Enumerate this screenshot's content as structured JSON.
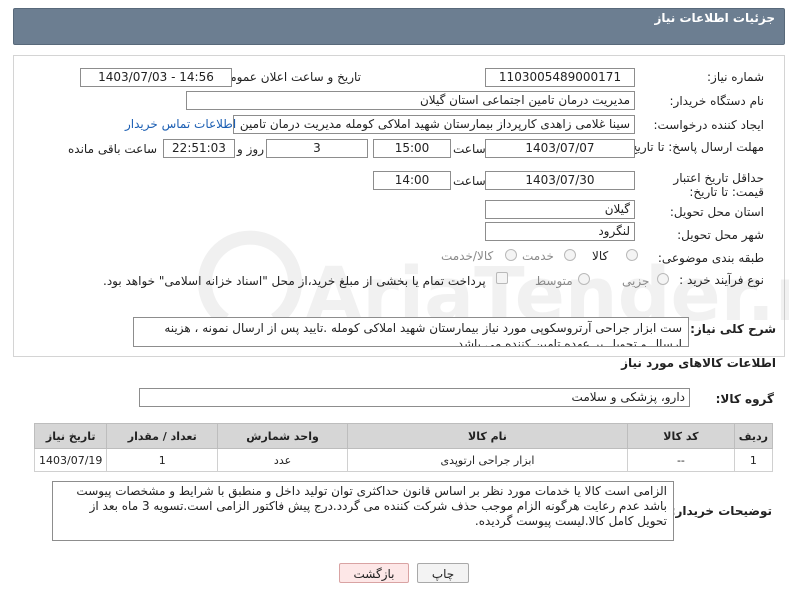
{
  "header": {
    "title": "جزئیات اطلاعات نیاز"
  },
  "watermark": {
    "text": "AriaTender.neT"
  },
  "form": {
    "need_number": {
      "label": "شماره نیاز:",
      "value": "1103005489000171"
    },
    "announce_datetime": {
      "label": "تاریخ و ساعت اعلان عمومی:",
      "value": "1403/07/03 - 14:56"
    },
    "buyer_org": {
      "label": "نام دستگاه خریدار:",
      "value": "مدیریت درمان تامین اجتماعی استان گیلان"
    },
    "requester": {
      "label": "ایجاد کننده درخواست:",
      "value": "سینا غلامی زاهدی کارپرداز بیمارستان شهید املاکی کومله مدیریت درمان تامین",
      "contact_link": "اطلاعات تماس خریدار"
    },
    "reply_deadline": {
      "label": "مهلت ارسال پاسخ: تا تاریخ:",
      "date": "1403/07/07",
      "time_label": "ساعت",
      "time": "15:00",
      "days": "3",
      "days_label": "روز و",
      "remaining": "22:51:03",
      "remaining_label": "ساعت باقی مانده"
    },
    "price_validity": {
      "label": "حداقل تاریخ اعتبار قیمت: تا تاریخ:",
      "date": "1403/07/30",
      "time_label": "ساعت",
      "time": "14:00"
    },
    "delivery_province": {
      "label": "استان محل تحویل:",
      "value": "گیلان"
    },
    "delivery_city": {
      "label": "شهر محل تحویل:",
      "value": "لنگرود"
    },
    "category": {
      "label": "طبقه بندی موضوعی:",
      "options": [
        "کالا",
        "خدمت",
        "کالا/خدمت"
      ]
    },
    "purchase_type": {
      "label": "نوع فرآیند خرید :",
      "options": [
        "جزیی",
        "متوسط"
      ],
      "treasury_note": "پرداخت تمام یا بخشی از مبلغ خرید،از محل \"اسناد خزانه اسلامی\" خواهد بود."
    },
    "need_description": {
      "label": "شرح کلی نیاز:",
      "value": "ست ابزار جراحی آرتروسکوپی مورد نیاز بیمارستان شهید املاکی کومله .تایید پس از ارسال نمونه ، هزینه ارسال و تحویل بر عهده تامین کننده می باشد."
    }
  },
  "goods_section": {
    "title": "اطلاعات کالاهای مورد نیاز",
    "group_label": "گروه کالا:",
    "group_value": "دارو، پزشکی و سلامت",
    "columns": [
      "ردیف",
      "کد کالا",
      "نام کالا",
      "واحد شمارش",
      "تعداد / مقدار",
      "تاریخ نیاز"
    ],
    "rows": [
      [
        "1",
        "--",
        "ابزار جراحی ارتوپدی",
        "عدد",
        "1",
        "1403/07/19"
      ]
    ]
  },
  "buyer_notes": {
    "label": "توضیحات خریدار:",
    "value": "الزامی است کالا یا خدمات مورد نظر بر اساس قانون حداکثری توان تولید داخل و منطبق با شرایط و مشخصات پیوست باشد عدم رعایت هرگونه الزام موجب حذف شرکت کننده می گردد.درج پیش فاکتور الزامی است.تسویه 3 ماه بعد از تحویل کامل کالا.لیست پیوست گردیده."
  },
  "buttons": {
    "print": "چاپ",
    "back": "بازگشت"
  }
}
